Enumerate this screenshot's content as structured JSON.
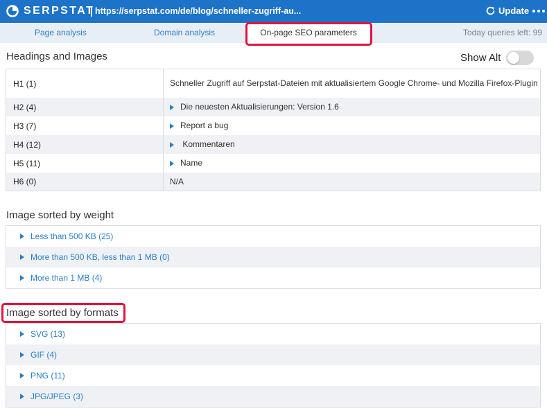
{
  "app": {
    "brand": "SERPSTAT",
    "separator": "|",
    "url": "https://serpstat.com/de/blog/schneller-zugriff-au...",
    "update_label": "Update",
    "more_icon": "more-icon",
    "refresh_icon": "refresh-icon",
    "accent": "#1d73c7"
  },
  "tabs": {
    "page_analysis": "Page analysis",
    "domain_analysis": "Domain analysis",
    "onpage": "On-page SEO parameters",
    "queries_left": "Today queries left: 99"
  },
  "headings": {
    "title": "Headings and Images",
    "show_alt_label": "Show Alt",
    "show_alt_on": false,
    "rows": [
      {
        "label": "H1 (1)",
        "value": "Schneller Zugriff auf Serpstat-Dateien mit aktualisiertem Google Chrome- und Mozilla Firefox-Plugin",
        "expandable": false
      },
      {
        "label": "H2 (4)",
        "value": "Die neuesten Aktualisierungen: Version 1.6",
        "expandable": true
      },
      {
        "label": "H3 (7)",
        "value": "Report a bug",
        "expandable": true
      },
      {
        "label": "H4 (12)",
        "value": " Kommentaren",
        "expandable": true
      },
      {
        "label": "H5 (11)",
        "value": "Name",
        "expandable": true
      },
      {
        "label": "H6 (0)",
        "value": "N/A",
        "expandable": false
      }
    ]
  },
  "by_weight": {
    "title": "Image sorted by weight",
    "items": [
      "Less than 500 KB (25)",
      "More than 500 KB, less than 1 MB (0)",
      "More than 1 MB (4)"
    ]
  },
  "by_format": {
    "title": "Image sorted by formats",
    "items": [
      "SVG (13)",
      "GIF (4)",
      "PNG (11)",
      "JPG/JPEG (3)"
    ]
  },
  "colors": {
    "link": "#2a7fc7",
    "highlight": "#e0143c",
    "alt_row": "#eff1f4"
  }
}
